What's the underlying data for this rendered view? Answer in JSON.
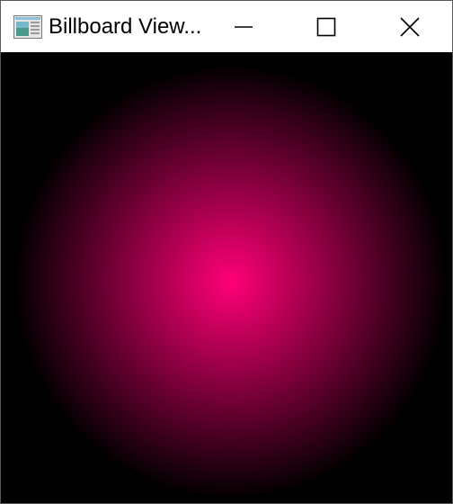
{
  "window": {
    "title": "Billboard View...",
    "app_icon": "app-window-icon",
    "controls": {
      "minimize_icon": "minimize-icon",
      "maximize_icon": "maximize-icon",
      "close_icon": "close-icon"
    }
  },
  "viewport": {
    "background_color": "#000000",
    "sphere": {
      "center_color": "#ff0077",
      "edge_color": "#000000"
    }
  }
}
